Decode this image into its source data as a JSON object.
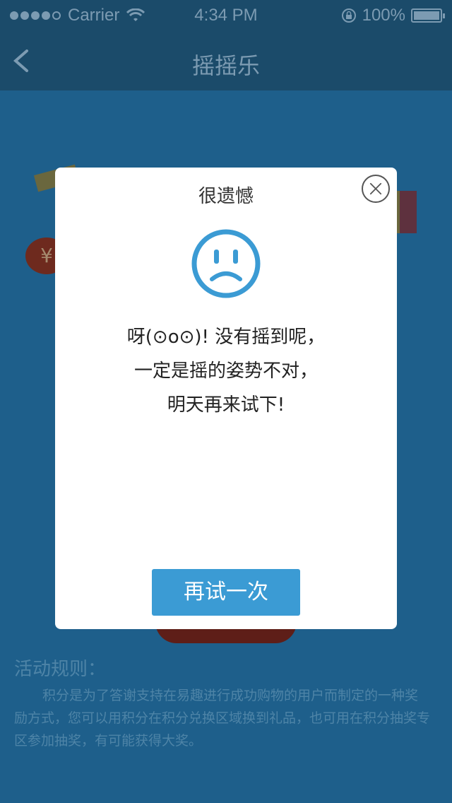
{
  "status_bar": {
    "carrier": "Carrier",
    "time": "4:34 PM",
    "battery": "100%"
  },
  "nav": {
    "title": "摇摇乐"
  },
  "modal": {
    "title": "很遗憾",
    "message_lines": [
      "呀(⊙o⊙)! 没有摇到呢，",
      "一定是摇的姿势不对，",
      "明天再来试下!"
    ],
    "retry_label": "再试一次"
  },
  "rules": {
    "title": "活动规则：",
    "text": "积分是为了答谢支持在易趣进行成功购物的用户而制定的一种奖励方式，您可以用积分在积分兑换区域换到礼品，也可用在积分抽奖专区参加抽奖，有可能获得大奖。"
  },
  "colors": {
    "accent": "#3b9bd4",
    "overlay_bg": "#1d5e8a",
    "nav_bg": "#1b4b6a"
  },
  "background": {
    "coin_symbol": "¥"
  }
}
